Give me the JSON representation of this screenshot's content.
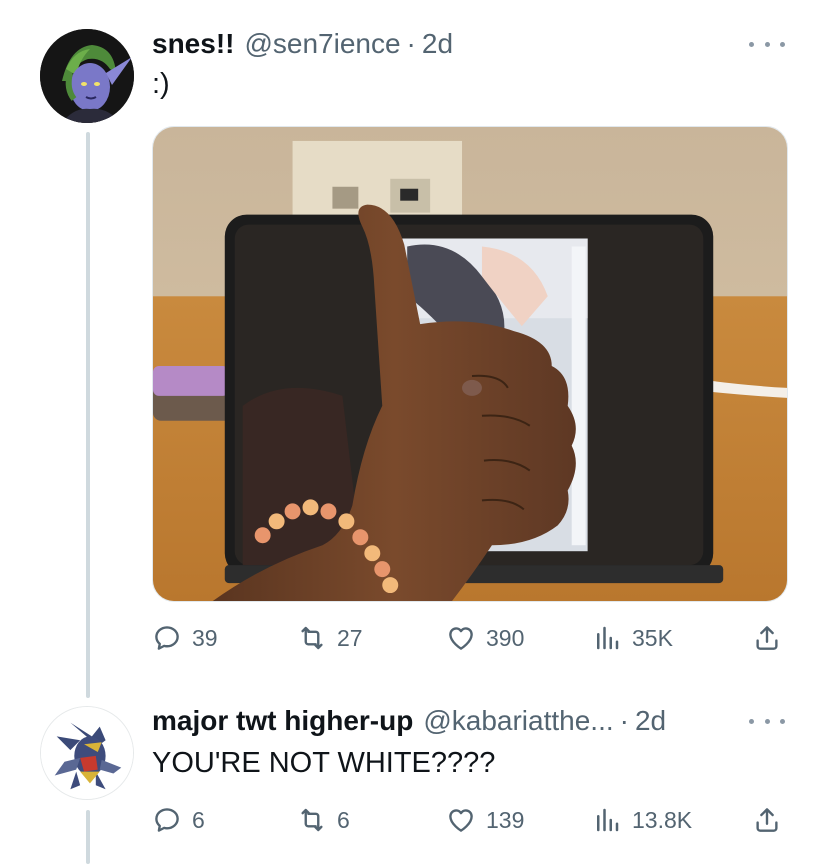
{
  "tweets": [
    {
      "display_name": "snes!!",
      "handle": "@sen7ience",
      "separator": "·",
      "time": "2d",
      "text": ":)",
      "avatar": "green-haired-elf-avatar",
      "media": "photo-thumbs-up-in-front-of-tablet",
      "actions": {
        "replies": "39",
        "retweets": "27",
        "likes": "390",
        "views": "35K"
      }
    },
    {
      "display_name": "major twt higher-up",
      "handle": "@kabariatthe...",
      "separator": "·",
      "time": "2d",
      "text": "YOU'RE NOT WHITE????",
      "avatar": "garchomp-avatar",
      "actions": {
        "replies": "6",
        "retweets": "6",
        "likes": "139",
        "views": "13.8K"
      }
    }
  ],
  "icons": {
    "reply": "reply-icon",
    "retweet": "retweet-icon",
    "like": "heart-icon",
    "views": "views-icon",
    "share": "share-icon",
    "more": "more-icon"
  },
  "colors": {
    "text": "#0f1419",
    "secondary": "#536471",
    "thread_line": "#cfd9de"
  }
}
